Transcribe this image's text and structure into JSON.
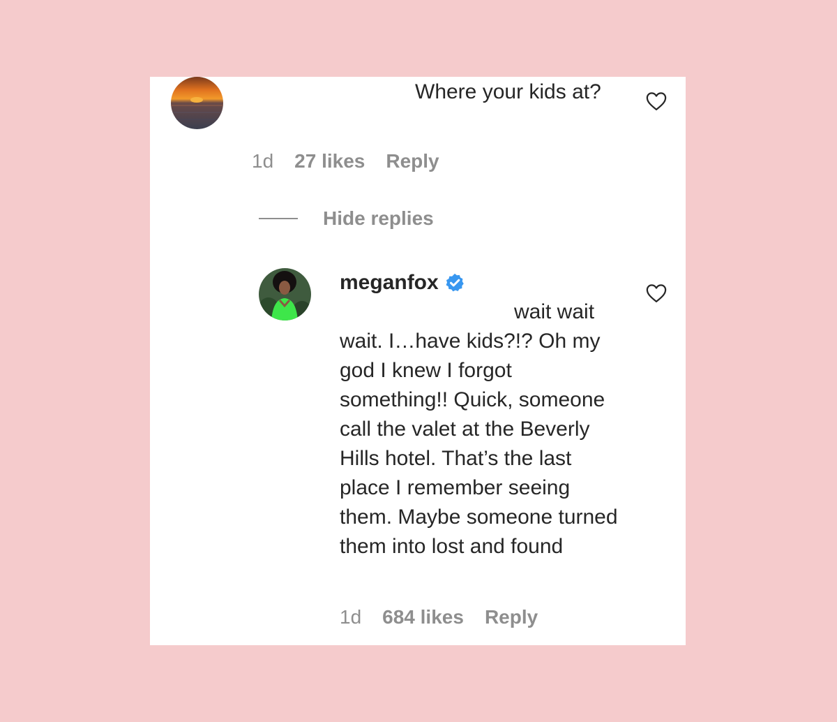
{
  "colors": {
    "background": "#f5cbcc",
    "card": "#ffffff",
    "text": "#262626",
    "muted": "#8e8e8e",
    "verified": "#3897f0"
  },
  "comment": {
    "text": "Where your kids at?",
    "meta": {
      "time": "1d",
      "likes": "27 likes",
      "reply": "Reply"
    },
    "avatar_icon": "sunset-avatar",
    "like_icon": "heart-outline-icon"
  },
  "replies_toggle": {
    "label": "Hide replies"
  },
  "reply": {
    "username": "meganfox",
    "verified_icon": "verified-badge-icon",
    "text": "wait wait wait. I…have kids?!? Oh my god I knew I forgot something!! Quick, someone call the valet at the Beverly Hills hotel. That’s the last place I remember seeing them. Maybe someone turned them into lost and found",
    "meta": {
      "time": "1d",
      "likes": "684 likes",
      "reply": "Reply"
    },
    "avatar_icon": "profile-photo-avatar",
    "like_icon": "heart-outline-icon"
  }
}
